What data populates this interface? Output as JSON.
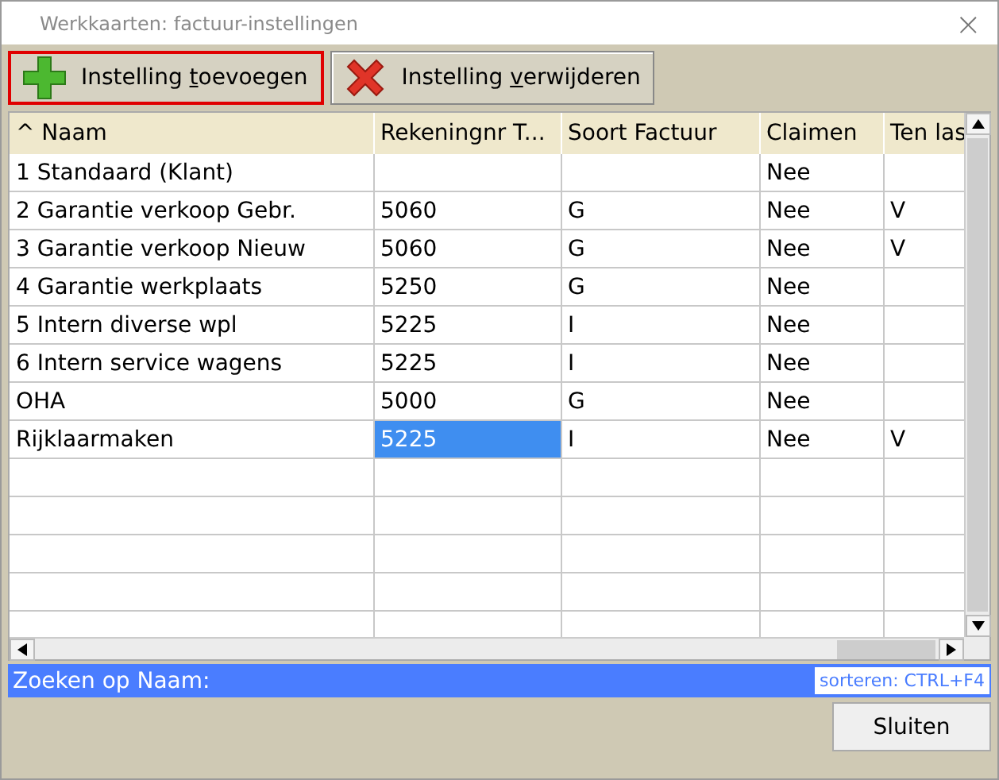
{
  "window": {
    "title": "Werkkaarten: factuur-instellingen",
    "close": "×"
  },
  "toolbar": [
    {
      "kind": "add",
      "focused": true,
      "label_before": "Instelling ",
      "access_key": "t",
      "label_after": "oevoegen"
    },
    {
      "kind": "delete",
      "focused": false,
      "label_before": "Instelling ",
      "access_key": "v",
      "label_after": "erwijderen"
    }
  ],
  "table": {
    "columns": [
      {
        "label": "^ Naam"
      },
      {
        "label": "Rekeningnr T..."
      },
      {
        "label": "Soort Factuur"
      },
      {
        "label": "Claimen"
      },
      {
        "label": "Ten las"
      }
    ],
    "rows": [
      {
        "cells": [
          {
            "text": "1 Standaard (Klant)",
            "selected": false
          },
          {
            "text": "",
            "selected": false
          },
          {
            "text": "",
            "selected": false
          },
          {
            "text": "Nee",
            "selected": false
          },
          {
            "text": "",
            "selected": false
          }
        ]
      },
      {
        "cells": [
          {
            "text": "2 Garantie verkoop Gebr.",
            "selected": false
          },
          {
            "text": "5060",
            "selected": false
          },
          {
            "text": "G",
            "selected": false
          },
          {
            "text": "Nee",
            "selected": false
          },
          {
            "text": "V",
            "selected": false
          }
        ]
      },
      {
        "cells": [
          {
            "text": "3 Garantie verkoop Nieuw",
            "selected": false
          },
          {
            "text": "5060",
            "selected": false
          },
          {
            "text": "G",
            "selected": false
          },
          {
            "text": "Nee",
            "selected": false
          },
          {
            "text": "V",
            "selected": false
          }
        ]
      },
      {
        "cells": [
          {
            "text": "4 Garantie werkplaats",
            "selected": false
          },
          {
            "text": "5250",
            "selected": false
          },
          {
            "text": "G",
            "selected": false
          },
          {
            "text": "Nee",
            "selected": false
          },
          {
            "text": "",
            "selected": false
          }
        ]
      },
      {
        "cells": [
          {
            "text": "5 Intern diverse wpl",
            "selected": false
          },
          {
            "text": "5225",
            "selected": false
          },
          {
            "text": "I",
            "selected": false
          },
          {
            "text": "Nee",
            "selected": false
          },
          {
            "text": "",
            "selected": false
          }
        ]
      },
      {
        "cells": [
          {
            "text": "6 Intern service wagens",
            "selected": false
          },
          {
            "text": "5225",
            "selected": false
          },
          {
            "text": "I",
            "selected": false
          },
          {
            "text": "Nee",
            "selected": false
          },
          {
            "text": "",
            "selected": false
          }
        ]
      },
      {
        "cells": [
          {
            "text": "OHA",
            "selected": false
          },
          {
            "text": "5000",
            "selected": false
          },
          {
            "text": "G",
            "selected": false
          },
          {
            "text": "Nee",
            "selected": false
          },
          {
            "text": "",
            "selected": false
          }
        ]
      },
      {
        "cells": [
          {
            "text": "Rijklaarmaken",
            "selected": false
          },
          {
            "text": "5225",
            "selected": true
          },
          {
            "text": "I",
            "selected": false
          },
          {
            "text": "Nee",
            "selected": false
          },
          {
            "text": "V",
            "selected": false
          }
        ]
      }
    ]
  },
  "search": {
    "label": "Zoeken op Naam:",
    "hint": "sorteren: CTRL+F4"
  },
  "buttons": [
    {
      "label": "Sluiten"
    }
  ]
}
